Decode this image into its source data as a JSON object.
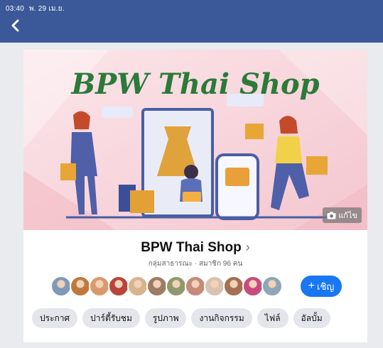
{
  "status_bar": {
    "time": "03:40",
    "date": "พ. 29 เม.ย."
  },
  "cover": {
    "title_text": "BPW Thai Shop",
    "edit_label": "แก้ไข"
  },
  "group": {
    "name": "BPW Thai Shop",
    "meta": "กลุ่มสาธารณะ · สมาชิก 96 คน"
  },
  "members": {
    "avatar_colors": [
      "#7f9ab8",
      "#c0793d",
      "#d89a6a",
      "#b8453c",
      "#d6b48e",
      "#9c7c63",
      "#8e9a6e",
      "#c58a7a",
      "#d8c3b0",
      "#a46f52",
      "#c84b7f",
      "#8ea7b6"
    ]
  },
  "invite": {
    "label": "เชิญ"
  },
  "tabs": [
    "ประกาศ",
    "ปาร์ตี้รับชม",
    "รูปภาพ",
    "งานกิจกรรม",
    "ไฟล์",
    "อัลบั้ม"
  ],
  "colors": {
    "brand": "#3b5998",
    "accent": "#1877f2"
  }
}
